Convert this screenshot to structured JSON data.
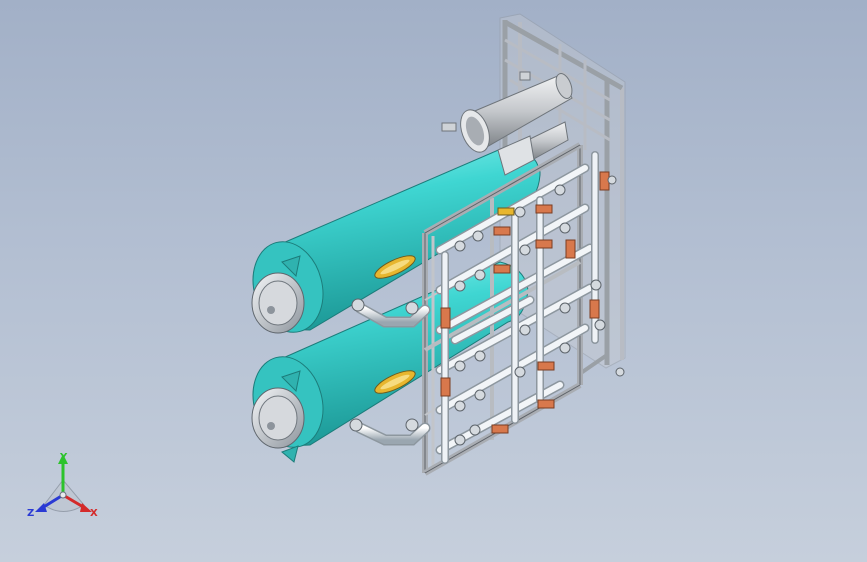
{
  "viewport": {
    "background_top": "#a2b0c7",
    "background_bottom": "#c6cfdc"
  },
  "colors": {
    "tank": "#3fd6d2",
    "tank_shadow": "#1f9a98",
    "frame": "#b8bcc4",
    "pipe": "#e8eef4",
    "valve": "#d8784c",
    "sight_glass": "#e8b830"
  },
  "triad": {
    "y_label": "Y",
    "x_label": "X",
    "z_label": "Z",
    "y_color": "#2cc32c",
    "x_color": "#d42a2a",
    "z_color": "#2a3ad4"
  }
}
